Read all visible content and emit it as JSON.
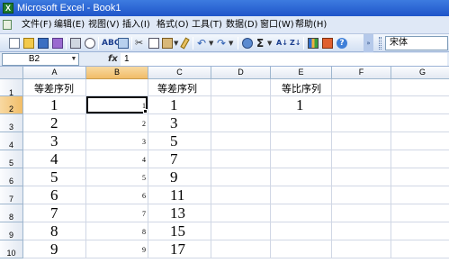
{
  "window": {
    "title": "Microsoft Excel - Book1",
    "app_icon": "excel-icon"
  },
  "menu": {
    "items": [
      "文件(F)",
      "编辑(E)",
      "视图(V)",
      "插入(I)",
      "格式(O)",
      "工具(T)",
      "数据(D)",
      "窗口(W)",
      "帮助(H)"
    ]
  },
  "toolbar": {
    "font_name": "宋体",
    "sum_symbol": "Σ",
    "sort_asc": "A↓",
    "sort_desc": "Z↓",
    "help_symbol": "?"
  },
  "formula_bar": {
    "name_box": "B2",
    "fx_label": "fx",
    "value": "1"
  },
  "grid": {
    "columns": [
      "A",
      "B",
      "C",
      "D",
      "E",
      "F",
      "G"
    ],
    "active_column": "B",
    "rows": [
      "1",
      "2",
      "3",
      "4",
      "5",
      "6",
      "7",
      "8",
      "9",
      "10"
    ],
    "active_row": "2",
    "headers": {
      "A": "等差序列",
      "C": "等差序列",
      "E": "等比序列"
    },
    "col_a": [
      "1",
      "2",
      "3",
      "4",
      "5",
      "6",
      "7",
      "8",
      "9"
    ],
    "col_b": [
      "1",
      "2",
      "3",
      "4",
      "5",
      "6",
      "7",
      "8",
      "9"
    ],
    "col_c": [
      "1",
      "3",
      "5",
      "7",
      "9",
      "11",
      "13",
      "15",
      "17"
    ],
    "col_e": [
      "1"
    ]
  }
}
